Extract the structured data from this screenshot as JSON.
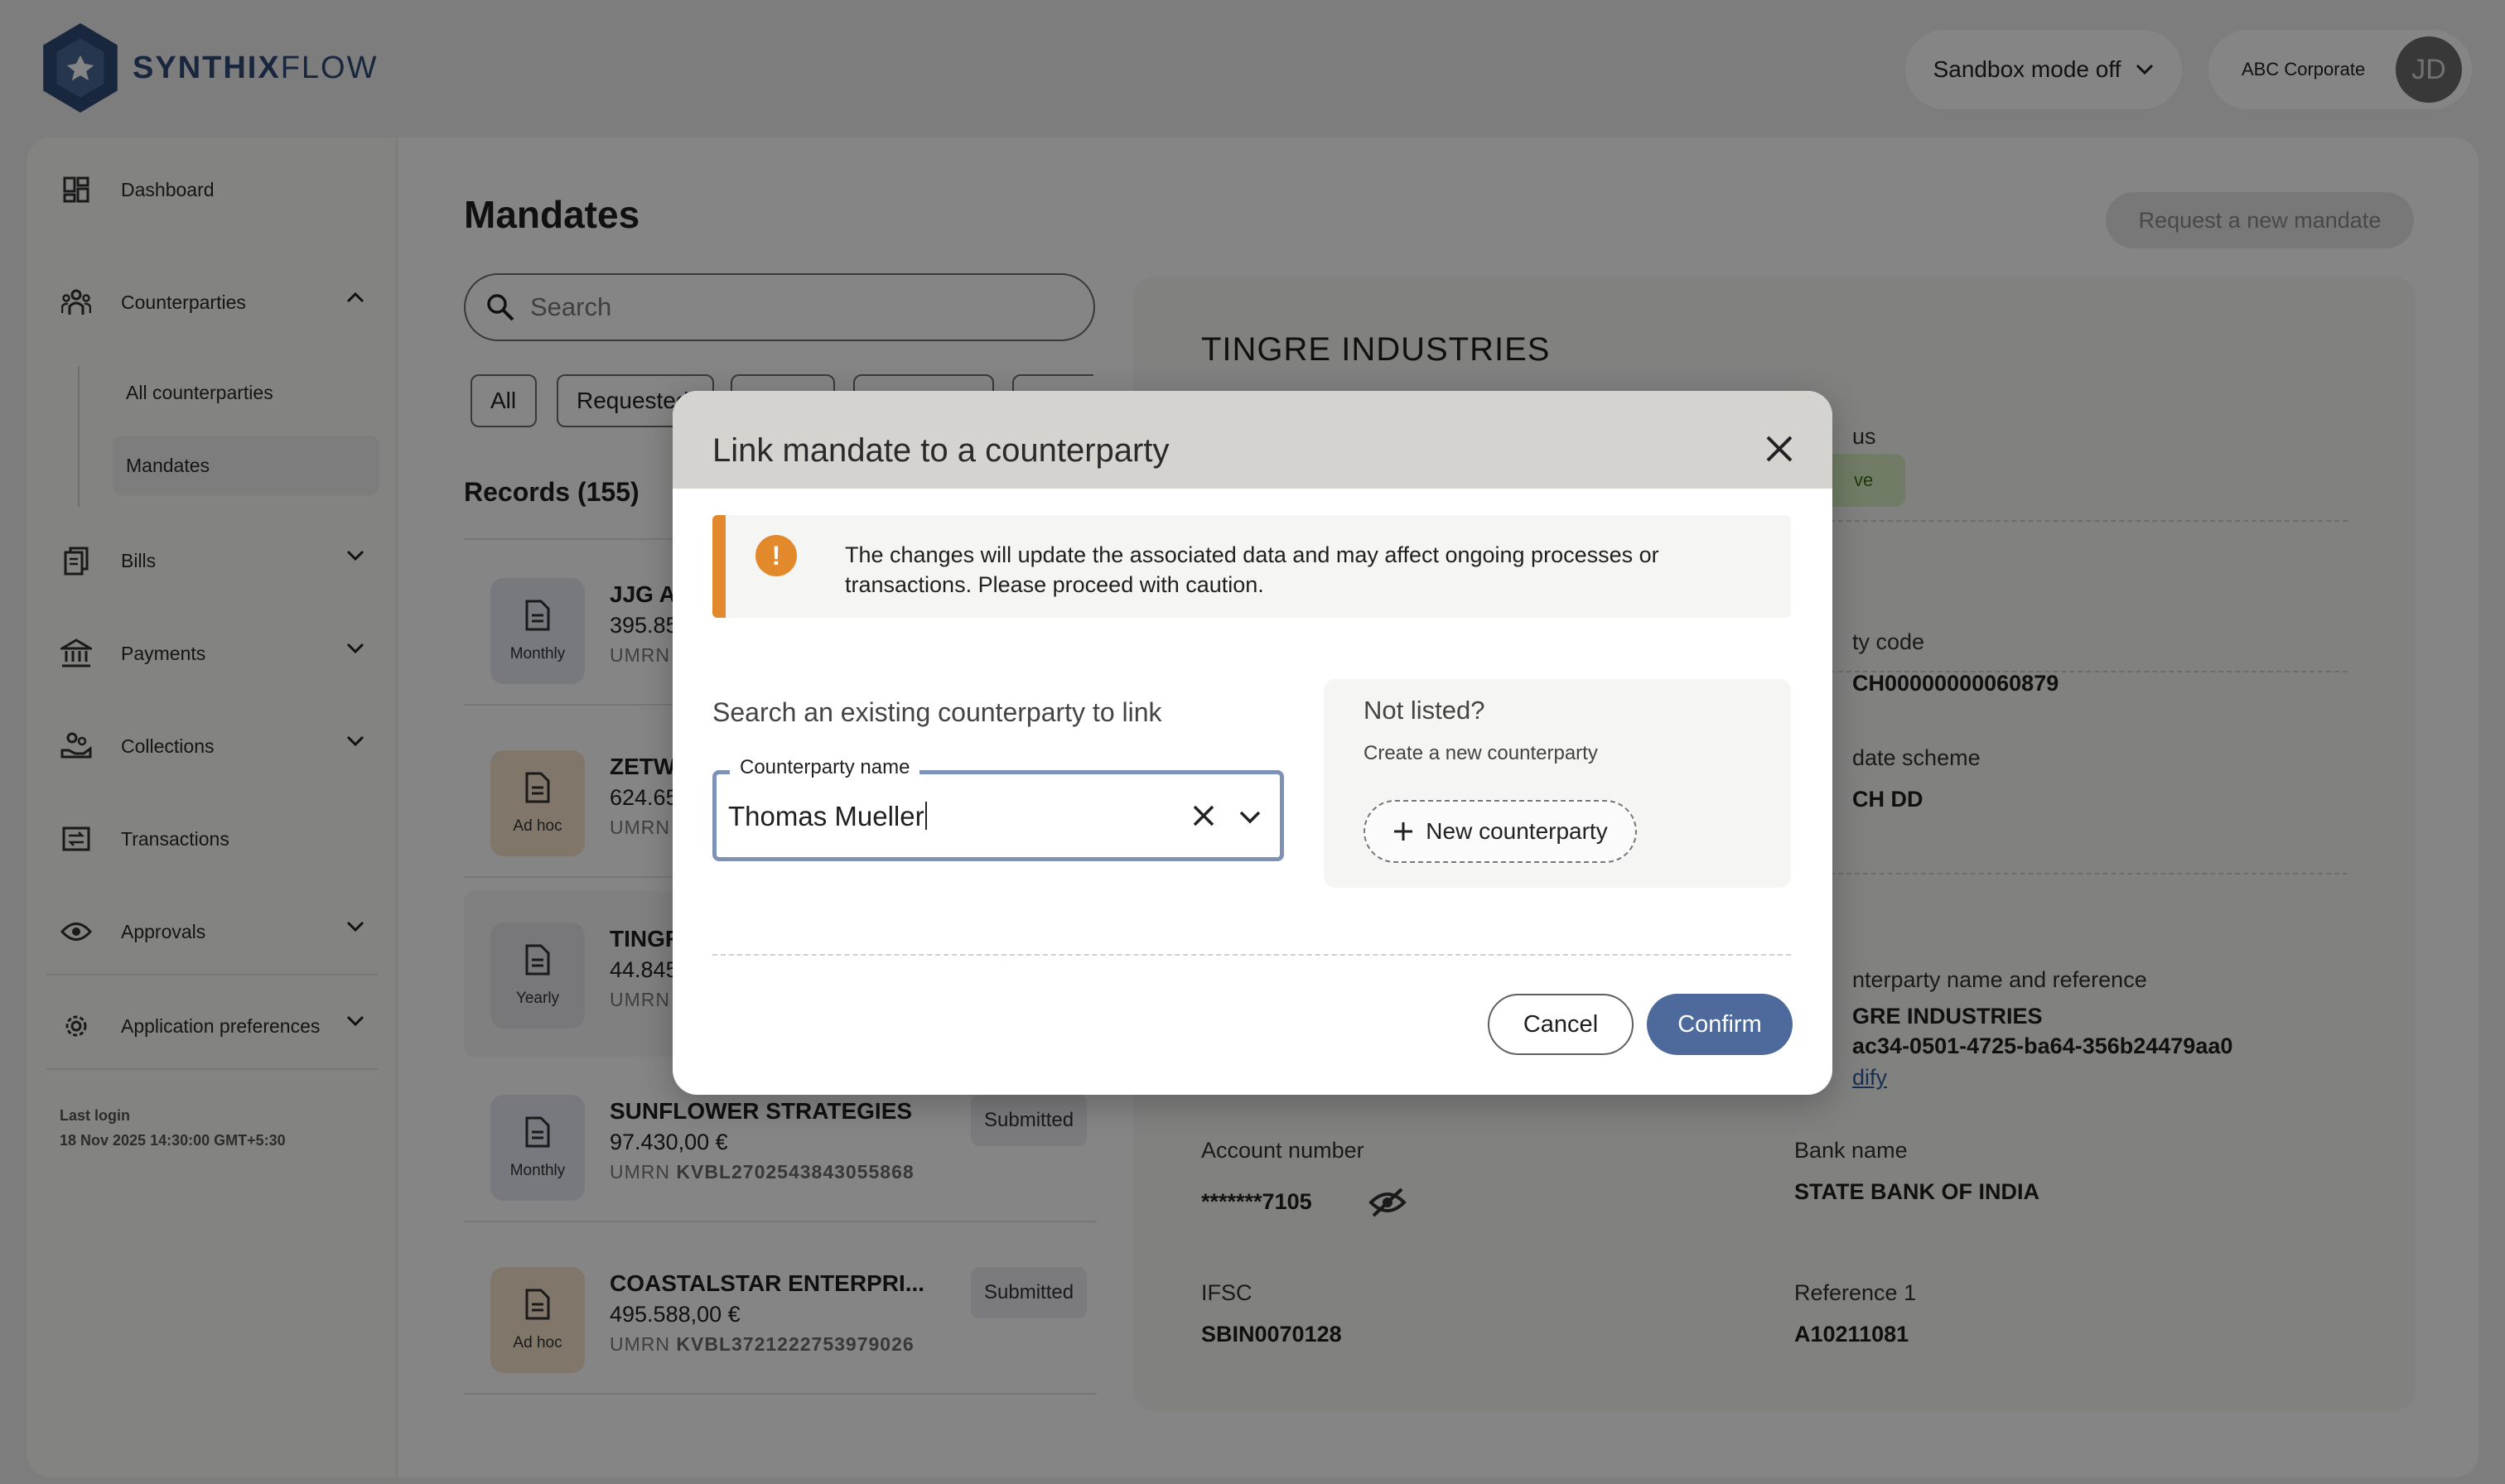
{
  "brand": {
    "name_bold": "SYNTHIX",
    "name_light": "FLOW"
  },
  "header": {
    "sandbox_label": "Sandbox mode off",
    "company": "ABC Corporate",
    "avatar_initials": "JD"
  },
  "sidebar": {
    "items": [
      {
        "label": "Dashboard",
        "icon": "dashboard-icon"
      },
      {
        "label": "Counterparties",
        "icon": "people-icon",
        "expanded": true
      },
      {
        "label": "Bills",
        "icon": "bills-icon"
      },
      {
        "label": "Payments",
        "icon": "bank-icon"
      },
      {
        "label": "Collections",
        "icon": "collections-icon"
      },
      {
        "label": "Transactions",
        "icon": "transactions-icon"
      },
      {
        "label": "Approvals",
        "icon": "eye-icon"
      },
      {
        "label": "Application preferences",
        "icon": "gear-icon"
      }
    ],
    "sub_items": [
      "All counterparties",
      "Mandates"
    ],
    "last_login_label": "Last login",
    "last_login_value": "18 Nov 2025 14:30:00 GMT+5:30"
  },
  "main": {
    "title": "Mandates",
    "request_button": "Request a new mandate",
    "search_placeholder": "Search",
    "filters": [
      "All",
      "Requested",
      "",
      "",
      ""
    ],
    "records_label": "Records (155)",
    "rows": [
      {
        "frequency": "Monthly",
        "name": "JJG A",
        "amount": "395.85",
        "umrn_label": "UMRN",
        "umrn": "",
        "status": ""
      },
      {
        "frequency": "Ad hoc",
        "name": "ZETW",
        "amount": "624.65",
        "umrn_label": "UMRN",
        "umrn": "",
        "status": ""
      },
      {
        "frequency": "Yearly",
        "name": "TINGR",
        "amount": "44.845",
        "umrn_label": "UMRN",
        "umrn": "",
        "status": ""
      },
      {
        "frequency": "Monthly",
        "name": "SUNFLOWER STRATEGIES",
        "amount": "97.430,00 €",
        "umrn_label": "UMRN",
        "umrn": "KVBL2702543843055868",
        "status": "Submitted"
      },
      {
        "frequency": "Ad hoc",
        "name": "COASTALSTAR ENTERPRI...",
        "amount": "495.588,00 €",
        "umrn_label": "UMRN",
        "umrn": "KVBL3721222753979026",
        "status": "Submitted"
      }
    ]
  },
  "detail": {
    "title": "TINGRE INDUSTRIES",
    "status_label": "us",
    "status_value": "ve",
    "utility_code_label": "ty code",
    "utility_code_value": "CH00000000060879",
    "scheme_label": "date scheme",
    "scheme_value": "CH DD",
    "cp_label": "nterparty name and reference",
    "cp_name": "GRE INDUSTRIES",
    "cp_ref": "ac34-0501-4725-ba64-356b24479aa0",
    "modify": "dify",
    "account_label": "Account number",
    "account_value": "*******7105",
    "bank_label": "Bank name",
    "bank_value": "STATE BANK OF INDIA",
    "ifsc_label": "IFSC",
    "ifsc_value": "SBIN0070128",
    "ref1_label": "Reference 1",
    "ref1_value": "A10211081"
  },
  "modal": {
    "title": "Link mandate to a counterparty",
    "warning": "The changes will update the associated data and may affect ongoing processes or transactions. Please proceed with caution.",
    "search_heading": "Search an existing counterparty to link",
    "field_label": "Counterparty name",
    "field_value": "Thomas Mueller",
    "not_listed_title": "Not listed?",
    "not_listed_sub": "Create a new counterparty",
    "new_button": "New counterparty",
    "cancel": "Cancel",
    "confirm": "Confirm"
  },
  "colors": {
    "brand_blue": "#2e4a78",
    "accent": "#4e6a9c",
    "warning": "#e2892c",
    "overlay": "rgba(0,0,0,0.48)"
  }
}
